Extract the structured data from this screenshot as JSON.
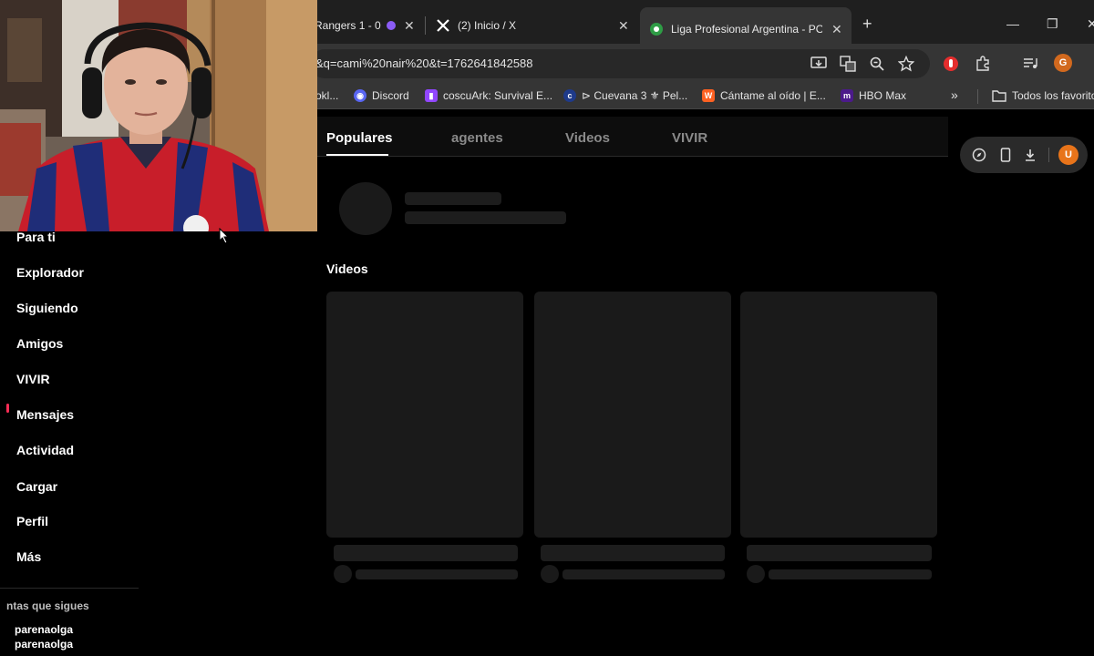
{
  "browser": {
    "tabs": [
      {
        "title": "Rangers 1 - 0",
        "favicon": "purple-dot-icon"
      },
      {
        "title": "(2) Inicio / X",
        "favicon": "x-logo-icon"
      },
      {
        "title": "Liga Profesional Argentina - PO",
        "favicon": "soccer-ball-icon",
        "active": true
      }
    ],
    "new_tab_label": "+",
    "url": "&q=cami%20nair%20&t=1762641842588",
    "profile_initial": "G",
    "bookmarks": [
      {
        "label": "okl...",
        "icon": "bookmark-icon"
      },
      {
        "label": "Discord",
        "icon": "discord-icon",
        "color": "#5865f2"
      },
      {
        "label": "coscuArk: Survival E...",
        "icon": "twitch-icon",
        "color": "#9146ff"
      },
      {
        "label": "⊳ Cuevana 3 ⚜ Pel...",
        "icon": "cuevana-icon",
        "color": "#3d5afe"
      },
      {
        "label": "Cántame al oído | E...",
        "icon": "wattpad-icon",
        "color": "#ff6122"
      },
      {
        "label": "HBO Max",
        "icon": "hbo-max-icon",
        "color": "#7b2cbf"
      }
    ],
    "bookmarks_overflow": "»",
    "all_bookmarks_label": "Todos los favoritos"
  },
  "page": {
    "tabs": [
      "Populares",
      "agentes",
      "Videos",
      "VIVIR"
    ],
    "active_tab": "Populares",
    "section_title": "Videos",
    "user_initial": "U"
  },
  "sidebar": {
    "items": [
      {
        "label": "Para ti"
      },
      {
        "label": "Explorador"
      },
      {
        "label": "Siguiendo"
      },
      {
        "label": "Amigos"
      },
      {
        "label": "VIVIR"
      },
      {
        "label": "Mensajes"
      },
      {
        "label": "Actividad"
      },
      {
        "label": "Cargar"
      },
      {
        "label": "Perfil"
      },
      {
        "label": "Más"
      }
    ],
    "following_title": "ntas que sigues",
    "following": [
      "parenaolga",
      "parenaolga"
    ]
  },
  "colors": {
    "accent_red": "#fe2c55",
    "profile_orange": "#e8741a"
  }
}
